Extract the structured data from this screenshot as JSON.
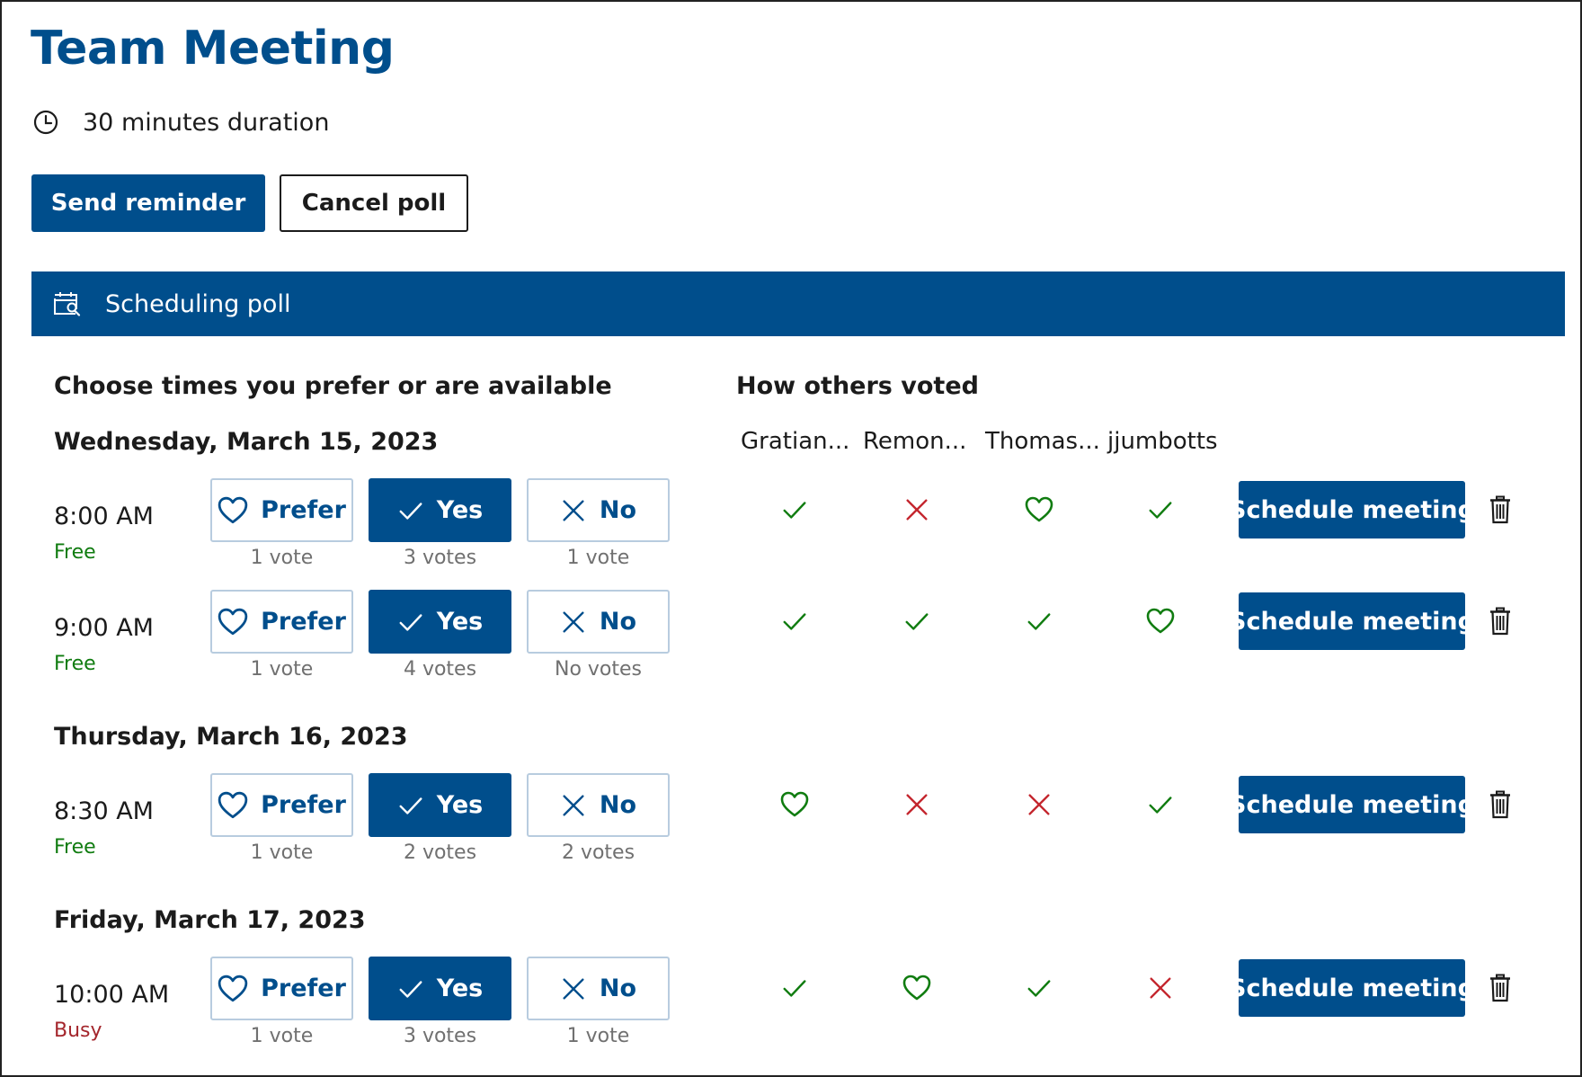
{
  "meeting": {
    "title": "Team Meeting",
    "duration_text": "30 minutes duration",
    "send_reminder_label": "Send reminder",
    "cancel_poll_label": "Cancel poll"
  },
  "banner": {
    "label": "Scheduling poll",
    "icon": "calendar-search-icon"
  },
  "poll": {
    "choose_heading": "Choose times you prefer or are available",
    "others_heading": "How others voted",
    "voters": [
      "Gratian...",
      "Remon...",
      "Thomas...",
      "jjumbotts"
    ],
    "choice_labels": {
      "prefer": "Prefer",
      "yes": "Yes",
      "no": "No"
    },
    "schedule_label": "Schedule meeting",
    "dates": [
      {
        "label": "Wednesday, March 15, 2023",
        "slots": [
          {
            "time": "8:00 AM",
            "status": "Free",
            "status_type": "free",
            "selected": "yes",
            "prefer_votes": "1 vote",
            "yes_votes": "3 votes",
            "no_votes": "1 vote",
            "votes": [
              "yes",
              "no",
              "prefer",
              "yes"
            ]
          },
          {
            "time": "9:00 AM",
            "status": "Free",
            "status_type": "free",
            "selected": "yes",
            "prefer_votes": "1 vote",
            "yes_votes": "4 votes",
            "no_votes": "No votes",
            "votes": [
              "yes",
              "yes",
              "yes",
              "prefer"
            ]
          }
        ]
      },
      {
        "label": "Thursday, March 16, 2023",
        "slots": [
          {
            "time": "8:30 AM",
            "status": "Free",
            "status_type": "free",
            "selected": "yes",
            "prefer_votes": "1 vote",
            "yes_votes": "2 votes",
            "no_votes": "2 votes",
            "votes": [
              "prefer",
              "no",
              "no",
              "yes"
            ]
          }
        ]
      },
      {
        "label": "Friday, March 17, 2023",
        "slots": [
          {
            "time": "10:00 AM",
            "status": "Busy",
            "status_type": "busy",
            "selected": "yes",
            "prefer_votes": "1 vote",
            "yes_votes": "3 votes",
            "no_votes": "1 vote",
            "votes": [
              "yes",
              "prefer",
              "yes",
              "no"
            ]
          }
        ]
      }
    ]
  },
  "colors": {
    "brand": "#004e8c",
    "free": "#107c10",
    "busy": "#a4262c",
    "vote_yes": "#107c10",
    "vote_no": "#c4262e",
    "vote_prefer": "#107c10"
  }
}
